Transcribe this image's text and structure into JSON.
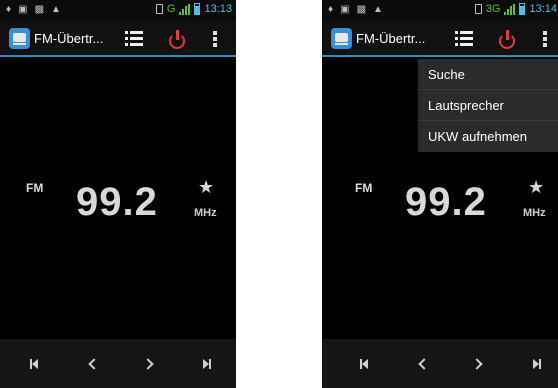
{
  "screens": [
    {
      "status": {
        "network": "G",
        "time": "13:13"
      },
      "app_title": "FM-Übertr...",
      "band": "FM",
      "frequency": "99.2",
      "unit": "MHz",
      "menu_open": false
    },
    {
      "status": {
        "network": "3G",
        "time": "13:14"
      },
      "app_title": "FM-Übertr...",
      "band": "FM",
      "frequency": "99.2",
      "unit": "MHz",
      "menu_open": true,
      "menu": [
        "Suche",
        "Lautsprecher",
        "UKW aufnehmen"
      ]
    }
  ],
  "icons": {
    "status_left": [
      "wifi-icon",
      "gallery-icon",
      "image-icon",
      "warning-icon"
    ],
    "action_bar": [
      "fm-transmitter-app-icon",
      "list-icon",
      "power-icon",
      "overflow-menu-icon"
    ],
    "favorite": "star-icon",
    "bottom_bar": [
      "skip-previous-icon",
      "seek-back-icon",
      "seek-forward-icon",
      "skip-next-icon"
    ]
  },
  "colors": {
    "accent": "#2a8fbf",
    "power": "#e23b3b",
    "clock": "#4ec0e8",
    "signal": "#5fbf3b",
    "screen_bg": "#000000"
  }
}
